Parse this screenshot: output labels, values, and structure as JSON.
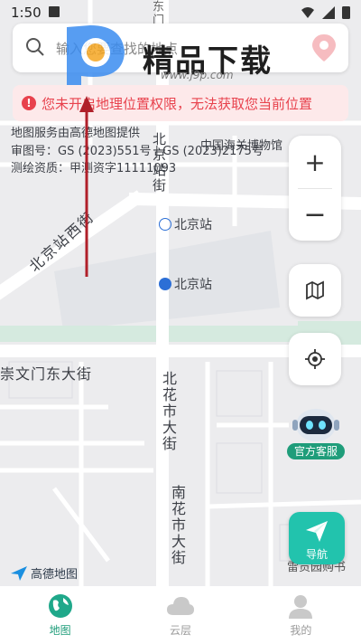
{
  "status_bar": {
    "time": "1:50"
  },
  "search": {
    "placeholder": "输入您要查找的地点"
  },
  "watermark": {
    "brand": "精品下载",
    "url": "www.j9p.com"
  },
  "alert": {
    "text": "您未开启地理位置权限，无法获取您当前位置",
    "color": "#e8424d"
  },
  "map": {
    "attribution": [
      "地图服务由高德地图提供",
      "审图号：GS (2023)551号 | GS (2023)2175号",
      "测绘资质：甲测资字11111093"
    ],
    "labels": {
      "beijing_zhan_jie": "北京站街",
      "customs_museum": "中国海关博物馆",
      "beijing_zhan_subway": "北京站",
      "beijing_zhan_xi_jie": "北京站西街",
      "beijing_zhan_poi": "北京站",
      "chongwenmen_dongdajie": "崇文门东大街",
      "bei_huashi_dajie": "北花市大街",
      "nan_huashi_dajie": "南花市大街",
      "poi_bottom": "雷贡园购书",
      "top_street": "东门"
    },
    "logo": "高德地图"
  },
  "controls": {
    "zoom_in": "+",
    "zoom_out": "−",
    "customer_service": "官方客服",
    "navigate": "导航"
  },
  "tabs": [
    {
      "label": "地图",
      "icon": "globe-icon",
      "active": true
    },
    {
      "label": "云层",
      "icon": "cloud-icon",
      "active": false
    },
    {
      "label": "我的",
      "icon": "user-icon",
      "active": false
    }
  ],
  "colors": {
    "accent": "#1f9d7a",
    "nav_button": "#22c3ad",
    "alert_bg": "#fde9ea"
  }
}
